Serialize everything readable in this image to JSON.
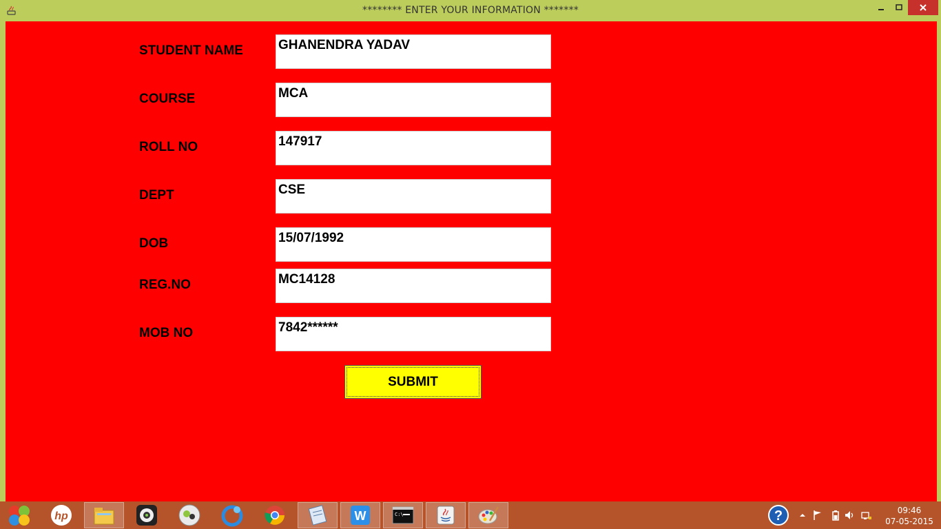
{
  "window": {
    "title": "********  ENTER YOUR INFORMATION  *******"
  },
  "form": {
    "fields": [
      {
        "label": "STUDENT NAME",
        "value": "GHANENDRA YADAV"
      },
      {
        "label": "COURSE",
        "value": "MCA"
      },
      {
        "label": "ROLL NO",
        "value": "147917"
      },
      {
        "label": "DEPT",
        "value": "CSE"
      },
      {
        "label": "DOB",
        "value": "15/07/1992"
      },
      {
        "label": "REG.NO",
        "value": "MC14128"
      },
      {
        "label": "MOB NO",
        "value": "7842******"
      }
    ],
    "submit_label": "SUBMIT"
  },
  "taskbar": {
    "items": [
      {
        "icon": "windows-start-icon"
      },
      {
        "icon": "hp-icon"
      },
      {
        "icon": "file-explorer-icon",
        "active": true
      },
      {
        "icon": "webcam-icon"
      },
      {
        "icon": "media-player-icon"
      },
      {
        "icon": "browser-blue-icon"
      },
      {
        "icon": "chrome-icon"
      },
      {
        "icon": "notepad-icon",
        "active": true
      },
      {
        "icon": "wps-writer-icon",
        "active": true
      },
      {
        "icon": "command-prompt-icon",
        "active": true
      },
      {
        "icon": "java-icon",
        "active": true
      },
      {
        "icon": "paint-icon",
        "active": true
      }
    ],
    "clock_time": "09:46",
    "clock_date": "07-05-2015"
  },
  "colors": {
    "client_bg": "#ff0000",
    "titlebar_bg": "#bccd5b",
    "submit_bg": "#ffff00",
    "taskbar_bg": "#b5542a"
  }
}
